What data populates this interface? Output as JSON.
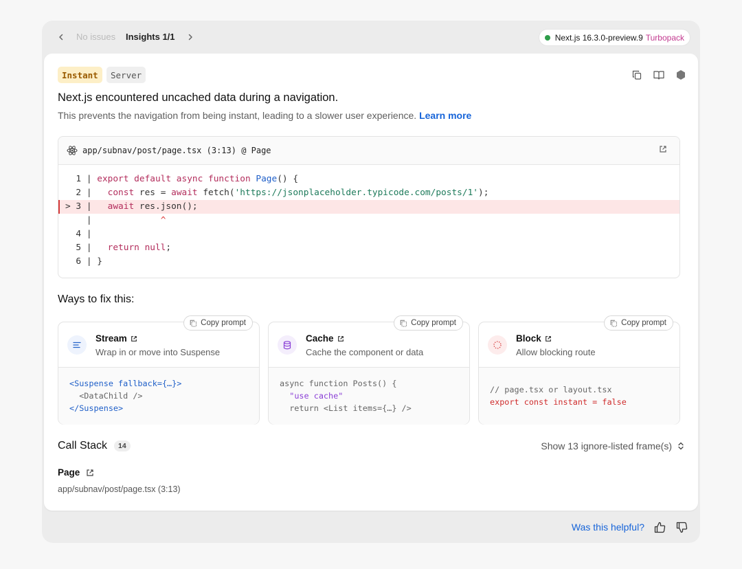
{
  "topbar": {
    "no_issues": "No issues",
    "insights": "Insights 1/1",
    "nextjs_version": "Next.js 16.3.0-preview.9",
    "bundler": "Turbopack"
  },
  "header": {
    "badges": [
      "Instant",
      "Server"
    ],
    "title": "Next.js encountered uncached data during a navigation.",
    "description": "This prevents the navigation from being instant, leading to a slower user experience.",
    "learn_more": "Learn more"
  },
  "codeframe": {
    "file": "app/subnav/post/page.tsx (3:13) @ Page"
  },
  "fixes": {
    "heading": "Ways to fix this:",
    "copy_label": "Copy prompt",
    "items": [
      {
        "title": "Stream",
        "subtitle": "Wrap in or move into Suspense"
      },
      {
        "title": "Cache",
        "subtitle": "Cache the component or data"
      },
      {
        "title": "Block",
        "subtitle": "Allow blocking route"
      }
    ]
  },
  "callstack": {
    "heading": "Call Stack",
    "count": "14",
    "show_frames": "Show 13 ignore-listed frame(s)",
    "frame_name": "Page",
    "frame_path": "app/subnav/post/page.tsx (3:13)"
  },
  "feedback": {
    "question": "Was this helpful?"
  },
  "colors": {
    "accent_blue": "#1664d9",
    "status_green": "#2e9d4a",
    "turbopack_pink": "#c2398f",
    "instant_badge_bg": "#fdefc7",
    "error_line_bg": "#fde6e6"
  }
}
